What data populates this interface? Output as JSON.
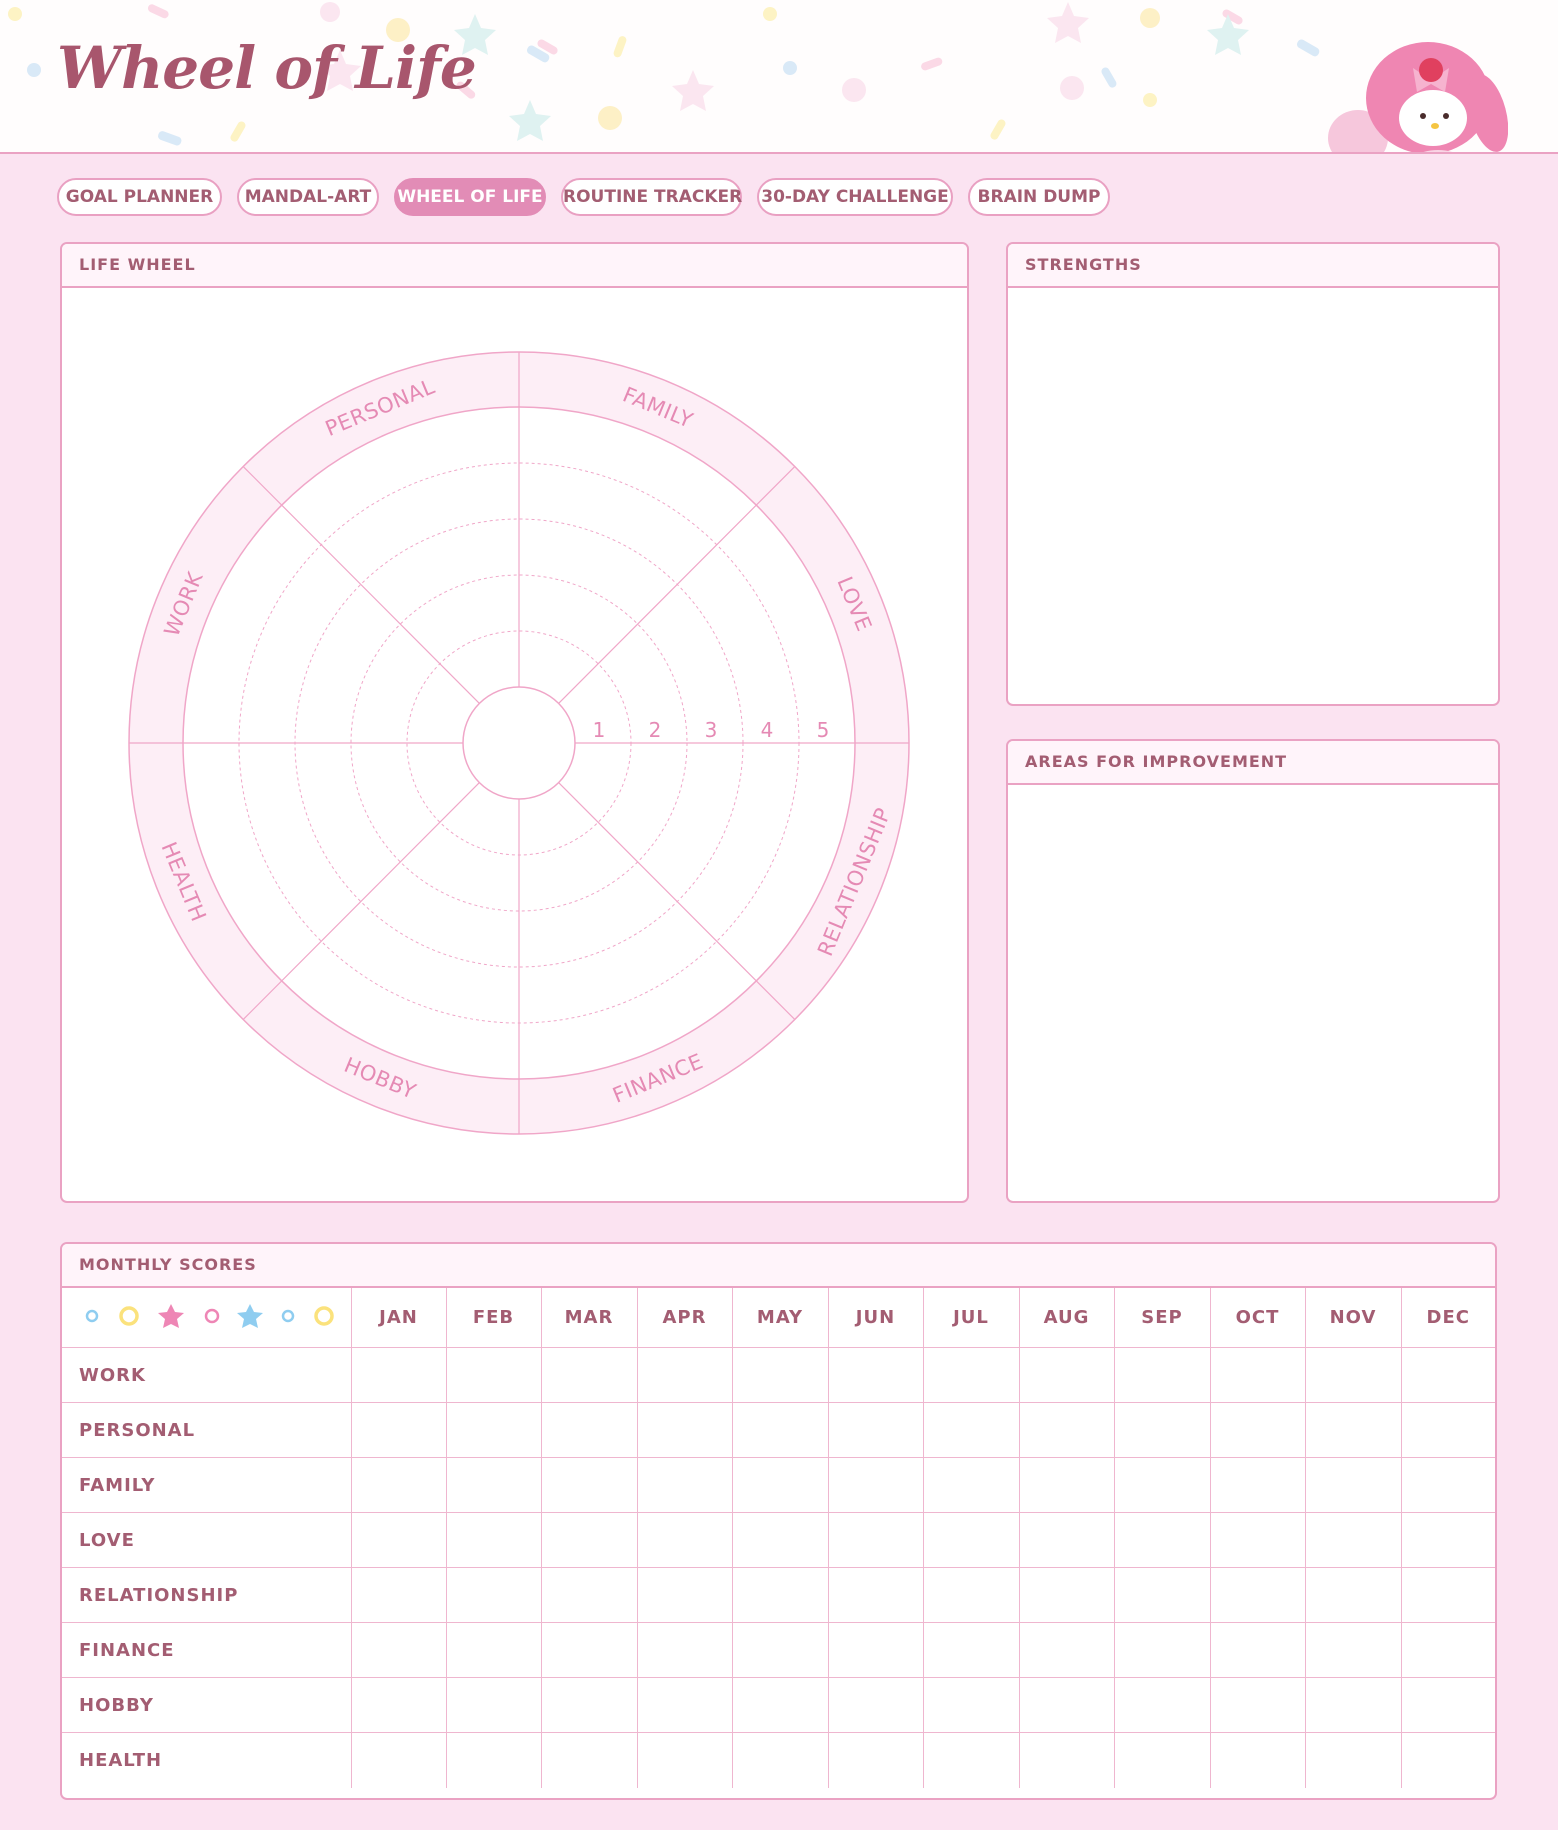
{
  "page_title": "Wheel of Life",
  "nav": {
    "tabs": [
      {
        "label": "GOAL PLANNER"
      },
      {
        "label": "MANDAL-ART"
      },
      {
        "label": "WHEEL OF LIFE"
      },
      {
        "label": "ROUTINE TRACKER"
      },
      {
        "label": "30-DAY CHALLENGE"
      },
      {
        "label": "BRAIN DUMP"
      }
    ],
    "active_tab": "WHEEL OF LIFE"
  },
  "life_wheel": {
    "header": "LIFE WHEEL",
    "segments": [
      "WORK",
      "PERSONAL",
      "FAMILY",
      "LOVE",
      "RELATIONSHIP",
      "FINANCE",
      "HOBBY",
      "HEALTH"
    ],
    "scale": [
      "1",
      "2",
      "3",
      "4",
      "5"
    ]
  },
  "strengths": {
    "header": "STRENGTHS",
    "content": ""
  },
  "areas_for_improvement": {
    "header": "AREAS FOR IMPROVEMENT",
    "content": ""
  },
  "monthly_scores": {
    "header": "MONTHLY SCORES",
    "months": [
      "JAN",
      "FEB",
      "MAR",
      "APR",
      "MAY",
      "JUN",
      "JUL",
      "AUG",
      "SEP",
      "OCT",
      "NOV",
      "DEC"
    ],
    "rows": [
      "WORK",
      "PERSONAL",
      "FAMILY",
      "LOVE",
      "RELATIONSHIP",
      "FINANCE",
      "HOBBY",
      "HEALTH"
    ],
    "header_decoration": [
      "ring-icon",
      "ring-icon",
      "star-icon",
      "ring-icon",
      "star-icon",
      "ring-icon",
      "ring-icon"
    ]
  },
  "colors": {
    "background": "#fbe3f1",
    "border": "#eaa2c3",
    "accent": "#e28cb6",
    "text": "#a35d72",
    "title": "#a8566d",
    "wheel_ring": "#fdeef6",
    "wheel_line": "#f0a6c8",
    "wheel_text": "#e58ab4"
  }
}
